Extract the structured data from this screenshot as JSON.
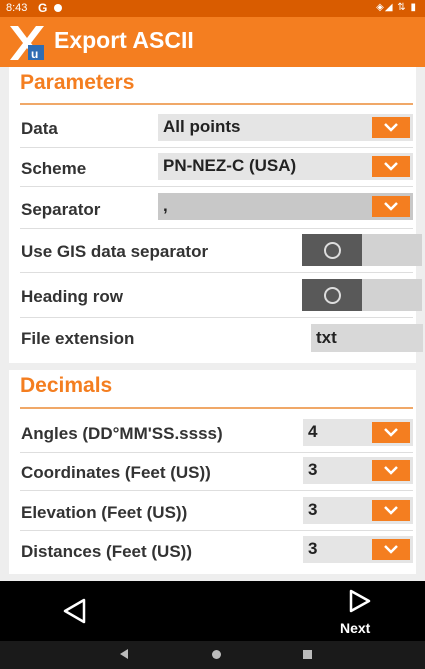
{
  "status_bar": {
    "time": "8:43",
    "g_icon": "G",
    "right_icons": "◈◢ ⇅ ▮"
  },
  "app": {
    "title": "Export ASCII",
    "accent": "#f47e20"
  },
  "parameters": {
    "title": "Parameters",
    "data": {
      "label": "Data",
      "value": "All points"
    },
    "scheme": {
      "label": "Scheme",
      "value": "PN-NEZ-C (USA)"
    },
    "separator": {
      "label": "Separator",
      "value": ","
    },
    "use_gis": {
      "label": "Use GIS data separator",
      "on": false
    },
    "heading_row": {
      "label": "Heading row",
      "on": false
    },
    "file_extension": {
      "label": "File extension",
      "value": "txt"
    }
  },
  "decimals": {
    "title": "Decimals",
    "angles": {
      "label": "Angles (DD°MM'SS.ssss)",
      "value": "4"
    },
    "coordinates": {
      "label": "Coordinates (Feet (US))",
      "value": "3"
    },
    "elevation": {
      "label": "Elevation (Feet (US))",
      "value": "3"
    },
    "distances": {
      "label": "Distances (Feet (US))",
      "value": "3"
    }
  },
  "actions": {
    "next_label": "Next"
  }
}
